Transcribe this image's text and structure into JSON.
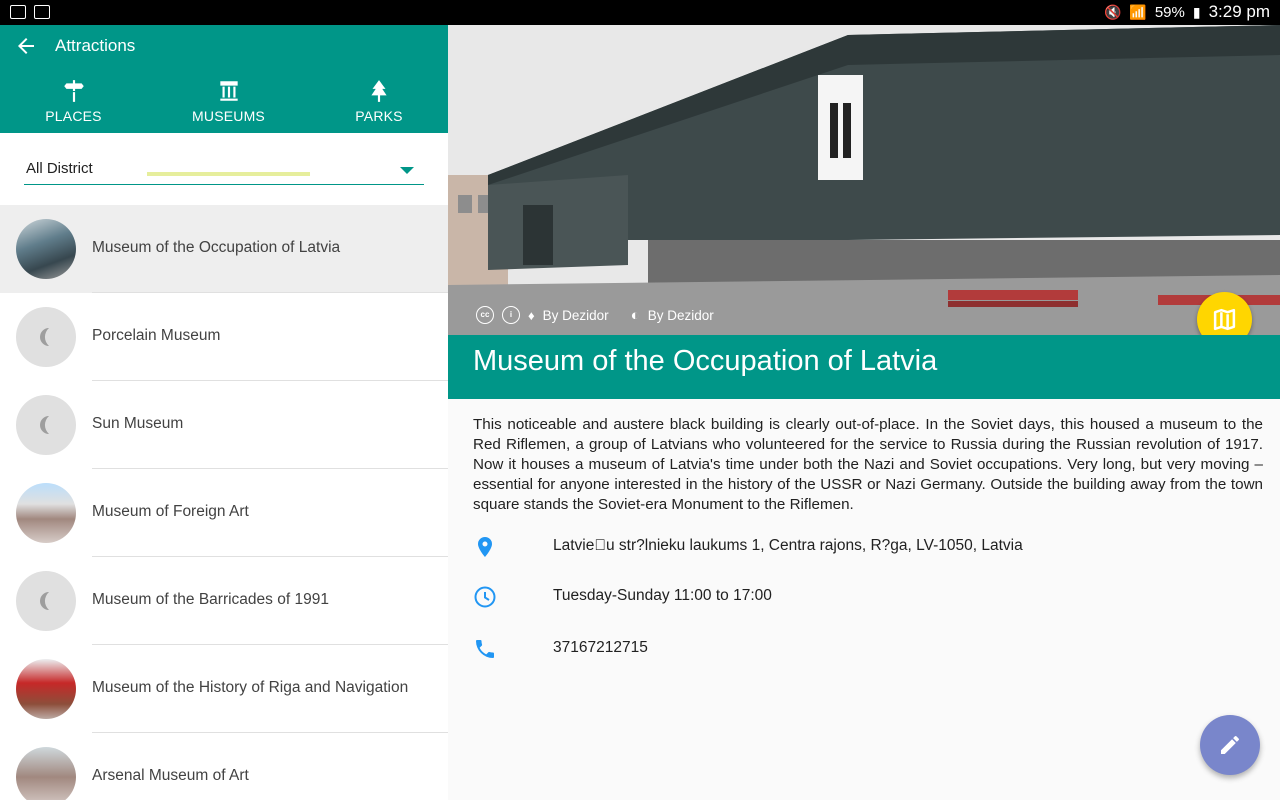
{
  "status_bar": {
    "battery": "59%",
    "time": "3:29 pm"
  },
  "toolbar": {
    "title": "Attractions"
  },
  "tabs": [
    {
      "label": "PLACES",
      "icon": "signpost-icon"
    },
    {
      "label": "MUSEUMS",
      "icon": "museum-icon",
      "selected": true
    },
    {
      "label": "PARKS",
      "icon": "tree-icon"
    }
  ],
  "filter": {
    "district": "All District"
  },
  "list": [
    {
      "name": "Museum of the Occupation of Latvia",
      "selected": true,
      "thumb": "photo"
    },
    {
      "name": "Porcelain Museum",
      "thumb": "placeholder"
    },
    {
      "name": "Sun Museum",
      "thumb": "placeholder"
    },
    {
      "name": "Museum of Foreign Art",
      "thumb": "photo"
    },
    {
      "name": "Museum of the Barricades of 1991",
      "thumb": "placeholder"
    },
    {
      "name": "Museum of the History of Riga and Navigation",
      "thumb": "photo"
    },
    {
      "name": "Arsenal Museum of Art",
      "thumb": "photo"
    }
  ],
  "detail": {
    "credit_1": "By Dezidor",
    "credit_2": "By Dezidor",
    "title": "Museum of the Occupation of Latvia",
    "description": "This noticeable and austere black building is clearly out-of-place. In the Soviet days, this housed a museum to the Red Riflemen, a group of Latvians who volunteered for the service to Russia during the Russian revolution of 1917. Now it houses a museum of Latvia's time under both the Nazi and Soviet occupations. Very long, but very moving – essential for anyone interested in the history of the USSR or Nazi Germany. Outside the building away from the town square stands the Soviet-era Monument to the Riflemen.",
    "address": "Latvie\u0000u str?lnieku laukums 1, Centra rajons, R?ga, LV-1050, Latvia",
    "hours": "Tuesday-Sunday 11:00 to 17:00",
    "phone": "37167212715"
  },
  "colors": {
    "primary": "#009688",
    "accent_fab": "#ffd600",
    "edit_fab": "#7986cb",
    "tab_indicator": "#e6ee9c"
  }
}
